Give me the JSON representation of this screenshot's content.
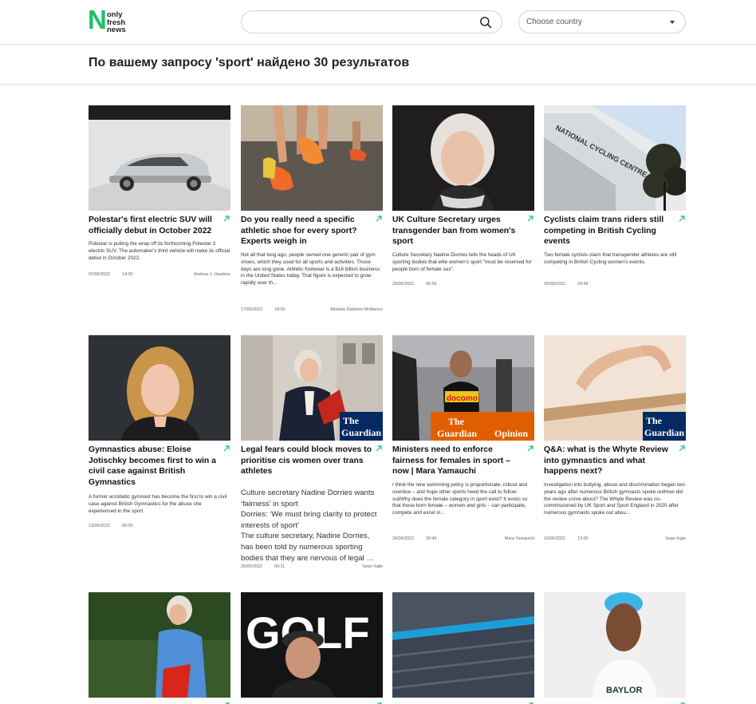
{
  "header": {
    "logo": {
      "letter": "N",
      "words": [
        "only",
        "fresh",
        "news"
      ]
    },
    "search": {
      "value": "",
      "placeholder": ""
    },
    "country": {
      "label": "Choose country"
    }
  },
  "results": {
    "title": "По вашему запросу 'sport' найдено 30 результатов"
  },
  "colors": {
    "accent": "#1bc06b",
    "guardian_blue": "#052962",
    "guardian_orange": "#e05e00"
  },
  "articles": [
    {
      "title": "Polestar's first electric SUV will officially debut in October 2022",
      "description": "Polestar is pulling the wrap off its forthcoming Polestar 3 electric SUV. The automaker's third vehicle will make its official debut in October 2022.",
      "date": "07/06/2022",
      "time": "14:00",
      "author": "Andrew J. Hawkins"
    },
    {
      "title": "Do you really need a specific athletic shoe for every sport? Experts weigh in",
      "description": "Not all that long ago, people owned one generic pair of gym shoes, which they used for all sports and activities. Those days are long gone. Athletic footwear is a $16 billion business in the United States today. That figure is expected to grow rapidly over th...",
      "date": "17/06/2022",
      "time": "18:00",
      "author": "Melanie Radzicki McManus"
    },
    {
      "title": "UK Culture Secretary urges transgender ban from women's sport",
      "description": "Culture Secretary Nadine Dorries tells the heads of UK sporting bodies that elite women's sport \"must be reserved for people born of female sex\".",
      "date": "29/06/2022",
      "time": "00:56",
      "author": ""
    },
    {
      "title": "Cyclists claim trans riders still competing in British Cycling events",
      "description": "Two female cyclists claim that transgender athletes are still competing in British Cycling women's events.",
      "date": "30/06/2022",
      "time": "20:49",
      "author": ""
    },
    {
      "title": "Gymnastics abuse: Eloise Jotischky becomes first to win a civil case against British Gymnastics",
      "description": "A former acrobatic gymnast has become the first to win a civil case against British Gymnastics for the abuse she experienced in the sport.",
      "date": "13/06/2022",
      "time": "00:00",
      "author": ""
    },
    {
      "title": "Legal fears could block moves to prioritise cis women over trans athletes",
      "description_lines": [
        "Culture secretary Nadine Dorries wants ‘fairness’ in sport",
        "Dorries: ‘We must bring clarity to protect interests of sport’",
        "The culture secretary, Nadine Dorries, has been told by numerous sporting bodies that they are nervous of legal …"
      ],
      "date": "29/06/2022",
      "time": "00:11",
      "author": "Sean Ingle"
    },
    {
      "title": "Ministers need to enforce fairness for females in sport – now | Mara Yamauchi",
      "description": "I think the new swimming policy is proportionate, robust and overdue – and hope other sports heed the call to follow suitWhy does the female category in sport exist? It exists so that those born female – women and girls – can participate, compete and excel in...",
      "date": "29/06/2022",
      "time": "20:40",
      "author": "Mara Yamauchi"
    },
    {
      "title": "Q&A: what is the Whyte Review into gymnastics and what happens next?",
      "description": "Investigation into bullying, abuse and discrimination began two years ago after numerous British gymnasts spoke outHow did the review come about? The Whyte Review was co-commissioned by UK Sport and Sport England in 2020 after numerous gymnasts spoke out abou...",
      "date": "16/06/2022",
      "time": "13:00",
      "author": "Sean Ingle"
    }
  ],
  "image_text": {
    "guardian": [
      "The",
      "Guardian"
    ],
    "guardian_opinion": "Opinion",
    "docomo": "docomo",
    "building_sign": "NATIONAL CYCLING CENTRE",
    "golf": "GOLF",
    "jersey": "BAYLOR"
  }
}
